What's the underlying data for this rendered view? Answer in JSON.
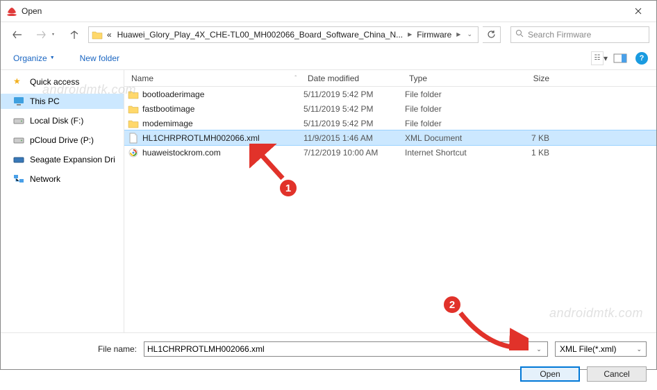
{
  "title": "Open",
  "breadcrumb": {
    "prefix": "«",
    "path1": "Huawei_Glory_Play_4X_CHE-TL00_MH002066_Board_Software_China_N...",
    "path2": "Firmware"
  },
  "search": {
    "placeholder": "Search Firmware"
  },
  "toolbar": {
    "organize": "Organize",
    "newfolder": "New folder"
  },
  "sidebar": {
    "items": [
      {
        "label": "Quick access"
      },
      {
        "label": "This PC"
      },
      {
        "label": "Local Disk (F:)"
      },
      {
        "label": "pCloud Drive (P:)"
      },
      {
        "label": "Seagate Expansion Dri"
      },
      {
        "label": "Network"
      }
    ]
  },
  "columns": {
    "name": "Name",
    "date": "Date modified",
    "type": "Type",
    "size": "Size"
  },
  "files": [
    {
      "name": "bootloaderimage",
      "date": "5/11/2019 5:42 PM",
      "type": "File folder",
      "size": ""
    },
    {
      "name": "fastbootimage",
      "date": "5/11/2019 5:42 PM",
      "type": "File folder",
      "size": ""
    },
    {
      "name": "modemimage",
      "date": "5/11/2019 5:42 PM",
      "type": "File folder",
      "size": ""
    },
    {
      "name": "HL1CHRPROTLMH002066.xml",
      "date": "11/9/2015 1:46 AM",
      "type": "XML Document",
      "size": "7 KB"
    },
    {
      "name": "huaweistockrom.com",
      "date": "7/12/2019 10:00 AM",
      "type": "Internet Shortcut",
      "size": "1 KB"
    }
  ],
  "filename": {
    "label": "File name:",
    "value": "HL1CHRPROTLMH002066.xml"
  },
  "filetype": {
    "label": "XML File(*.xml)"
  },
  "buttons": {
    "open": "Open",
    "cancel": "Cancel"
  },
  "annot": {
    "one": "1",
    "two": "2"
  },
  "watermark": "androidmtk.com"
}
